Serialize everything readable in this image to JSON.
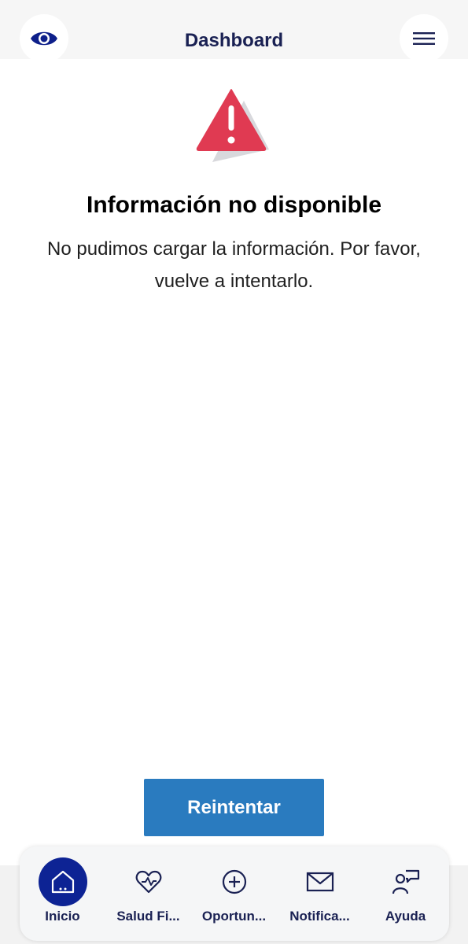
{
  "header": {
    "title": "Dashboard",
    "left_icon": "eye-icon",
    "right_icon": "hamburger-menu-icon"
  },
  "error": {
    "icon": "warning-triangle-icon",
    "title": "Información no disponible",
    "message": "No pudimos cargar la información. Por favor, vuelve a intentarlo."
  },
  "retry": {
    "label": "Reintentar"
  },
  "bottom_nav": {
    "items": [
      {
        "label": "Inicio",
        "icon": "home-icon",
        "active": true
      },
      {
        "label": "Salud Fi...",
        "icon": "heart-pulse-icon",
        "active": false
      },
      {
        "label": "Oportun...",
        "icon": "plus-circle-icon",
        "active": false
      },
      {
        "label": "Notifica...",
        "icon": "envelope-icon",
        "active": false
      },
      {
        "label": "Ayuda",
        "icon": "support-chat-icon",
        "active": false
      }
    ]
  },
  "colors": {
    "primary_navy": "#1a2153",
    "active_blue": "#0d2394",
    "button_blue": "#2a7bbf",
    "warning_red": "#e03a52"
  }
}
